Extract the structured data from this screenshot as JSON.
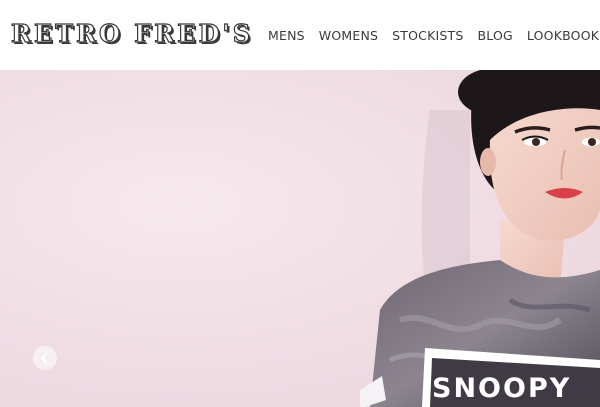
{
  "brand": {
    "logo_text": "RETRO FRED'S"
  },
  "nav": {
    "items": [
      {
        "label": "MENS"
      },
      {
        "label": "WOMENS"
      },
      {
        "label": "STOCKISTS"
      },
      {
        "label": "BLOG"
      },
      {
        "label": "LOOKBOOK"
      }
    ]
  },
  "hero": {
    "shirt_print_text": "SNOOPY",
    "background_color": "#f0dde4",
    "carousel_prev_icon": "chevron-left-icon"
  }
}
